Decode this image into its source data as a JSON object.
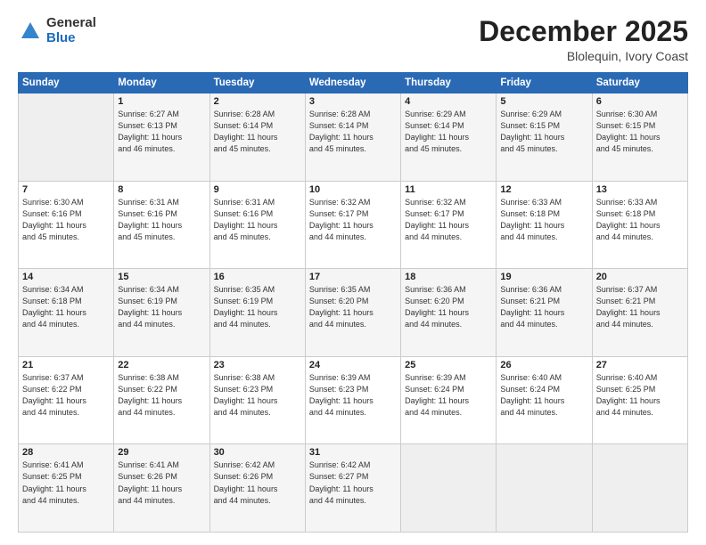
{
  "header": {
    "logo_general": "General",
    "logo_blue": "Blue",
    "month_title": "December 2025",
    "subtitle": "Blolequin, Ivory Coast"
  },
  "weekdays": [
    "Sunday",
    "Monday",
    "Tuesday",
    "Wednesday",
    "Thursday",
    "Friday",
    "Saturday"
  ],
  "rows": [
    [
      {
        "day": "",
        "info": ""
      },
      {
        "day": "1",
        "info": "Sunrise: 6:27 AM\nSunset: 6:13 PM\nDaylight: 11 hours\nand 46 minutes."
      },
      {
        "day": "2",
        "info": "Sunrise: 6:28 AM\nSunset: 6:14 PM\nDaylight: 11 hours\nand 45 minutes."
      },
      {
        "day": "3",
        "info": "Sunrise: 6:28 AM\nSunset: 6:14 PM\nDaylight: 11 hours\nand 45 minutes."
      },
      {
        "day": "4",
        "info": "Sunrise: 6:29 AM\nSunset: 6:14 PM\nDaylight: 11 hours\nand 45 minutes."
      },
      {
        "day": "5",
        "info": "Sunrise: 6:29 AM\nSunset: 6:15 PM\nDaylight: 11 hours\nand 45 minutes."
      },
      {
        "day": "6",
        "info": "Sunrise: 6:30 AM\nSunset: 6:15 PM\nDaylight: 11 hours\nand 45 minutes."
      }
    ],
    [
      {
        "day": "7",
        "info": "Sunrise: 6:30 AM\nSunset: 6:16 PM\nDaylight: 11 hours\nand 45 minutes."
      },
      {
        "day": "8",
        "info": "Sunrise: 6:31 AM\nSunset: 6:16 PM\nDaylight: 11 hours\nand 45 minutes."
      },
      {
        "day": "9",
        "info": "Sunrise: 6:31 AM\nSunset: 6:16 PM\nDaylight: 11 hours\nand 45 minutes."
      },
      {
        "day": "10",
        "info": "Sunrise: 6:32 AM\nSunset: 6:17 PM\nDaylight: 11 hours\nand 44 minutes."
      },
      {
        "day": "11",
        "info": "Sunrise: 6:32 AM\nSunset: 6:17 PM\nDaylight: 11 hours\nand 44 minutes."
      },
      {
        "day": "12",
        "info": "Sunrise: 6:33 AM\nSunset: 6:18 PM\nDaylight: 11 hours\nand 44 minutes."
      },
      {
        "day": "13",
        "info": "Sunrise: 6:33 AM\nSunset: 6:18 PM\nDaylight: 11 hours\nand 44 minutes."
      }
    ],
    [
      {
        "day": "14",
        "info": "Sunrise: 6:34 AM\nSunset: 6:18 PM\nDaylight: 11 hours\nand 44 minutes."
      },
      {
        "day": "15",
        "info": "Sunrise: 6:34 AM\nSunset: 6:19 PM\nDaylight: 11 hours\nand 44 minutes."
      },
      {
        "day": "16",
        "info": "Sunrise: 6:35 AM\nSunset: 6:19 PM\nDaylight: 11 hours\nand 44 minutes."
      },
      {
        "day": "17",
        "info": "Sunrise: 6:35 AM\nSunset: 6:20 PM\nDaylight: 11 hours\nand 44 minutes."
      },
      {
        "day": "18",
        "info": "Sunrise: 6:36 AM\nSunset: 6:20 PM\nDaylight: 11 hours\nand 44 minutes."
      },
      {
        "day": "19",
        "info": "Sunrise: 6:36 AM\nSunset: 6:21 PM\nDaylight: 11 hours\nand 44 minutes."
      },
      {
        "day": "20",
        "info": "Sunrise: 6:37 AM\nSunset: 6:21 PM\nDaylight: 11 hours\nand 44 minutes."
      }
    ],
    [
      {
        "day": "21",
        "info": "Sunrise: 6:37 AM\nSunset: 6:22 PM\nDaylight: 11 hours\nand 44 minutes."
      },
      {
        "day": "22",
        "info": "Sunrise: 6:38 AM\nSunset: 6:22 PM\nDaylight: 11 hours\nand 44 minutes."
      },
      {
        "day": "23",
        "info": "Sunrise: 6:38 AM\nSunset: 6:23 PM\nDaylight: 11 hours\nand 44 minutes."
      },
      {
        "day": "24",
        "info": "Sunrise: 6:39 AM\nSunset: 6:23 PM\nDaylight: 11 hours\nand 44 minutes."
      },
      {
        "day": "25",
        "info": "Sunrise: 6:39 AM\nSunset: 6:24 PM\nDaylight: 11 hours\nand 44 minutes."
      },
      {
        "day": "26",
        "info": "Sunrise: 6:40 AM\nSunset: 6:24 PM\nDaylight: 11 hours\nand 44 minutes."
      },
      {
        "day": "27",
        "info": "Sunrise: 6:40 AM\nSunset: 6:25 PM\nDaylight: 11 hours\nand 44 minutes."
      }
    ],
    [
      {
        "day": "28",
        "info": "Sunrise: 6:41 AM\nSunset: 6:25 PM\nDaylight: 11 hours\nand 44 minutes."
      },
      {
        "day": "29",
        "info": "Sunrise: 6:41 AM\nSunset: 6:26 PM\nDaylight: 11 hours\nand 44 minutes."
      },
      {
        "day": "30",
        "info": "Sunrise: 6:42 AM\nSunset: 6:26 PM\nDaylight: 11 hours\nand 44 minutes."
      },
      {
        "day": "31",
        "info": "Sunrise: 6:42 AM\nSunset: 6:27 PM\nDaylight: 11 hours\nand 44 minutes."
      },
      {
        "day": "",
        "info": ""
      },
      {
        "day": "",
        "info": ""
      },
      {
        "day": "",
        "info": ""
      }
    ]
  ]
}
